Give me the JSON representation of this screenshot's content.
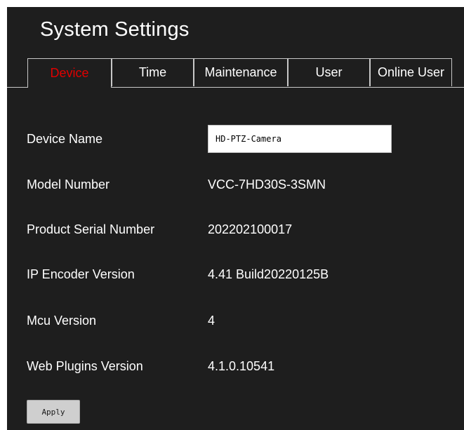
{
  "page": {
    "title": "System Settings"
  },
  "tabs": [
    {
      "label": "Device",
      "active": true
    },
    {
      "label": "Time",
      "active": false
    },
    {
      "label": "Maintenance",
      "active": false
    },
    {
      "label": "User",
      "active": false
    },
    {
      "label": "Online User",
      "active": false
    }
  ],
  "device": {
    "device_name_label": "Device Name",
    "device_name_value": "HD-PTZ-Camera",
    "model_number_label": "Model Number",
    "model_number_value": "VCC-7HD30S-3SMN",
    "serial_label": "Product Serial Number",
    "serial_value": "202202100017",
    "ip_encoder_label": "IP Encoder Version",
    "ip_encoder_value": "4.41 Build20220125B",
    "mcu_label": "Mcu Version",
    "mcu_value": "4",
    "web_plugins_label": "Web Plugins Version",
    "web_plugins_value": "4.1.0.10541"
  },
  "actions": {
    "apply_label": "Apply"
  },
  "colors": {
    "background": "#1e1e1e",
    "active_tab_text": "#e00000",
    "text": "#ffffff"
  }
}
